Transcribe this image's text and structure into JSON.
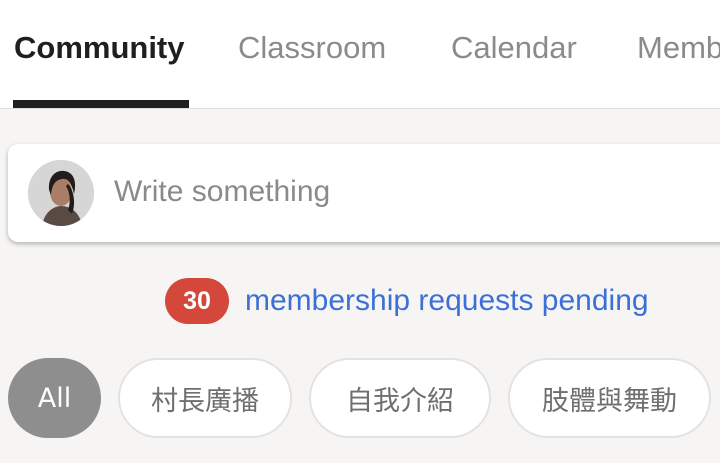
{
  "tabs": [
    {
      "label": "Community",
      "active": true
    },
    {
      "label": "Classroom",
      "active": false
    },
    {
      "label": "Calendar",
      "active": false
    },
    {
      "label": "Members",
      "active": false
    }
  ],
  "composer": {
    "placeholder": "Write something"
  },
  "requests": {
    "count": "30",
    "text": "membership requests pending"
  },
  "filters": [
    {
      "label": "All",
      "active": true
    },
    {
      "label": "村長廣播",
      "active": false
    },
    {
      "label": "自我介紹",
      "active": false
    },
    {
      "label": "肢體與舞動",
      "active": false
    }
  ],
  "colors": {
    "accent_link": "#3d70d6",
    "badge": "#d3483b",
    "active_chip": "#8e8e8e",
    "active_tab": "#1f1f1f"
  }
}
